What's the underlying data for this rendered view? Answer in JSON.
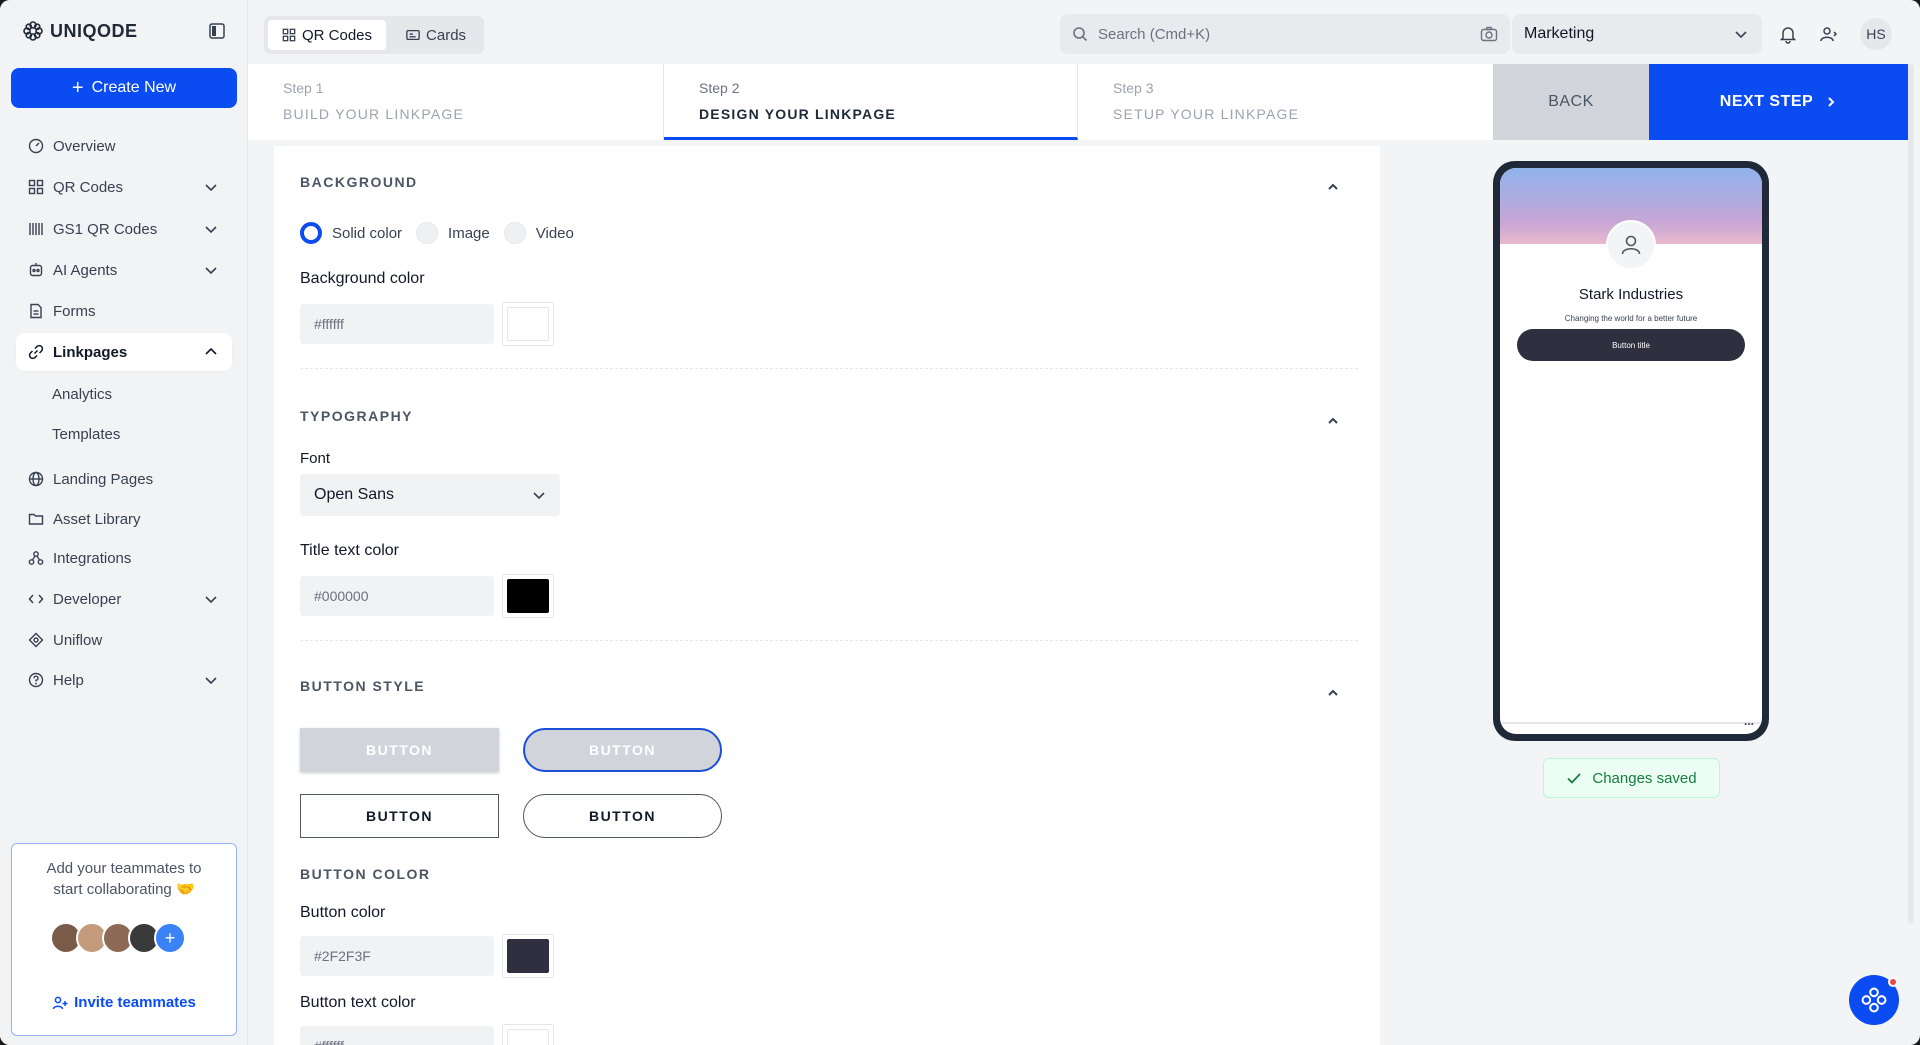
{
  "app": {
    "logo_text": "UNIQODE"
  },
  "sidebar": {
    "create_label": "Create New",
    "items": [
      {
        "label": "Overview"
      },
      {
        "label": "QR Codes"
      },
      {
        "label": "GS1 QR Codes"
      },
      {
        "label": "AI Agents"
      },
      {
        "label": "Forms"
      },
      {
        "label": "Linkpages"
      },
      {
        "label": "Landing Pages"
      },
      {
        "label": "Asset Library"
      },
      {
        "label": "Integrations"
      },
      {
        "label": "Developer"
      },
      {
        "label": "Uniflow"
      },
      {
        "label": "Help"
      }
    ],
    "sub_items": [
      {
        "label": "Analytics"
      },
      {
        "label": "Templates"
      }
    ],
    "invite": {
      "text_line1": "Add your teammates to",
      "text_line2": "start collaborating 🤝",
      "link_label": "Invite teammates"
    }
  },
  "topbar": {
    "tabs": [
      {
        "label": "QR Codes",
        "active": true
      },
      {
        "label": "Cards",
        "active": false
      }
    ],
    "search_placeholder": "Search (Cmd+K)",
    "workspace": "Marketing",
    "user_initials": "HS"
  },
  "steps": [
    {
      "num": "Step 1",
      "title": "BUILD YOUR LINKPAGE"
    },
    {
      "num": "Step 2",
      "title": "DESIGN YOUR LINKPAGE"
    },
    {
      "num": "Step 3",
      "title": "SETUP YOUR LINKPAGE"
    }
  ],
  "actions": {
    "back": "BACK",
    "next": "NEXT STEP"
  },
  "background": {
    "title": "BACKGROUND",
    "options": [
      "Solid color",
      "Image",
      "Video"
    ],
    "selected": "Solid color",
    "color_label": "Background color",
    "color_value": "#ffffff"
  },
  "typography": {
    "title": "TYPOGRAPHY",
    "font_label": "Font",
    "font_value": "Open Sans",
    "title_color_label": "Title text color",
    "title_color_value": "#000000"
  },
  "button_style": {
    "title": "BUTTON STYLE",
    "buttons": [
      "BUTTON",
      "BUTTON",
      "BUTTON",
      "BUTTON"
    ]
  },
  "button_color": {
    "title": "BUTTON COLOR",
    "color_label": "Button color",
    "color_value": "#2F2F3F",
    "text_color_label": "Button text color",
    "text_color_value": "#ffffff"
  },
  "preview": {
    "name": "Stark Industries",
    "tagline": "Changing the world for a better future",
    "button_title": "Button title",
    "dots": "..."
  },
  "status": {
    "saved": "Changes saved"
  },
  "colors": {
    "accent": "#0b4bf2",
    "button_swatch": "#2F2F3F",
    "title_swatch": "#000000"
  }
}
